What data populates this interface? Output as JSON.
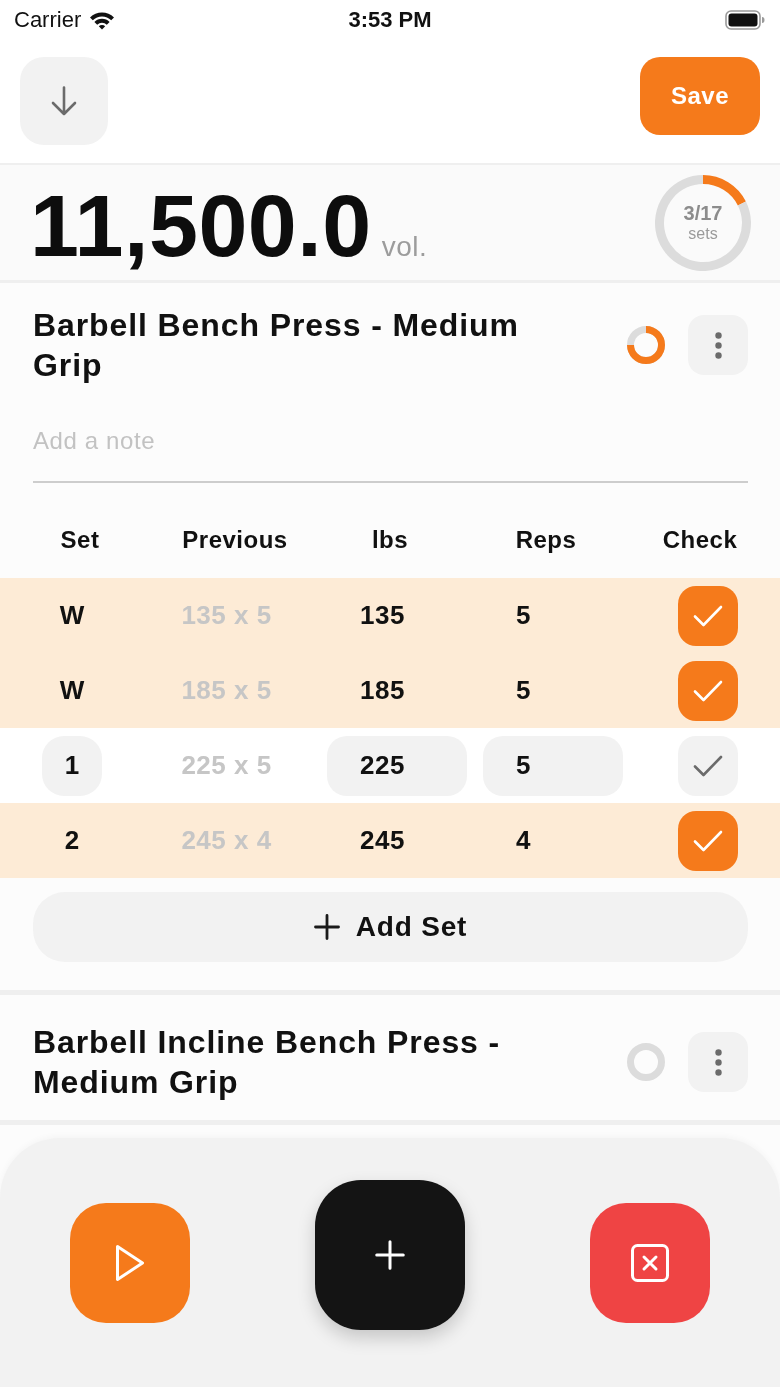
{
  "status_bar": {
    "carrier": "Carrier",
    "time": "3:53 PM"
  },
  "header": {
    "save_label": "Save"
  },
  "summary": {
    "volume": "11,500.0",
    "unit": "vol.",
    "sets_done": "3/17",
    "sets_label": "sets",
    "chart_data": {
      "type": "donut",
      "values": [
        17.6,
        82.4
      ]
    }
  },
  "exercises": [
    {
      "title": "Barbell Bench Press - Medium Grip",
      "note": {
        "placeholder": "Add a note"
      },
      "columns": [
        "Set",
        "Previous",
        "lbs",
        "Reps",
        "Check"
      ],
      "sets": [
        {
          "set": "W",
          "previous": "135 x 5",
          "lbs": "135",
          "reps": "5",
          "checked": true
        },
        {
          "set": "W",
          "previous": "185 x 5",
          "lbs": "185",
          "reps": "5",
          "checked": true
        },
        {
          "set": "1",
          "previous": "225 x 5",
          "lbs": "225",
          "reps": "5",
          "checked": false
        },
        {
          "set": "2",
          "previous": "245 x 4",
          "lbs": "245",
          "reps": "4",
          "checked": true
        }
      ],
      "add_set_label": "Add Set"
    },
    {
      "title": "Barbell Incline Bench Press - Medium Grip"
    }
  ]
}
